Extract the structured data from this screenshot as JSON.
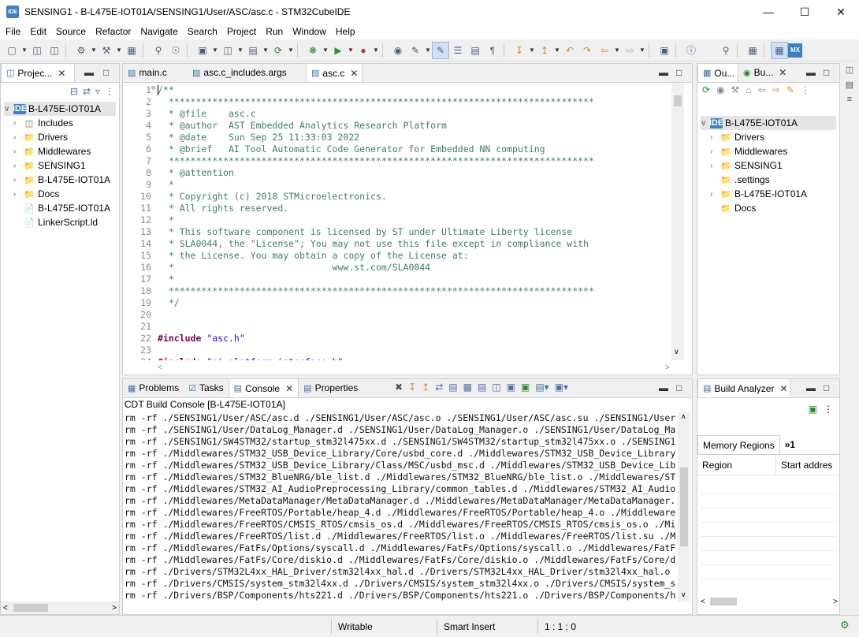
{
  "window": {
    "title": "SENSING1 - B-L475E-IOT01A/SENSING1/User/ASC/asc.c - STM32CubeIDE",
    "logo_text": "IDE"
  },
  "menu": [
    "File",
    "Edit",
    "Source",
    "Refactor",
    "Navigate",
    "Search",
    "Project",
    "Run",
    "Window",
    "Help"
  ],
  "project_explorer": {
    "tab_label": "Projec...",
    "root": "B-L475E-IOT01A",
    "items": [
      {
        "label": "Includes",
        "icon": "includes-icon"
      },
      {
        "label": "Drivers",
        "icon": "folder-icon"
      },
      {
        "label": "Middlewares",
        "icon": "folder-icon"
      },
      {
        "label": "SENSING1",
        "icon": "folder-icon"
      },
      {
        "label": "B-L475E-IOT01A",
        "icon": "folder-icon"
      },
      {
        "label": "Docs",
        "icon": "folder-icon"
      },
      {
        "label": "B-L475E-IOT01A",
        "icon": "file-icon"
      },
      {
        "label": "LinkerScript.ld",
        "icon": "file-icon"
      }
    ]
  },
  "editor": {
    "tabs": [
      "main.c",
      "asc.c_includes.args",
      "asc.c"
    ],
    "active_tab": "asc.c",
    "lines": [
      {
        "n": "1",
        "text": "/**",
        "cls": "cm",
        "fold": "⊖"
      },
      {
        "n": "2",
        "text": "  ******************************************************************************",
        "cls": "cm"
      },
      {
        "n": "3",
        "text": "  * @file    asc.c",
        "cls": "cm"
      },
      {
        "n": "4",
        "text": "  * @author  AST Embedded Analytics Research Platform",
        "cls": "cm"
      },
      {
        "n": "5",
        "text": "  * @date    Sun Sep 25 11:33:03 2022",
        "cls": "cm"
      },
      {
        "n": "6",
        "text": "  * @brief   AI Tool Automatic Code Generator for Embedded NN computing",
        "cls": "cm"
      },
      {
        "n": "7",
        "text": "  ******************************************************************************",
        "cls": "cm"
      },
      {
        "n": "8",
        "text": "  * @attention",
        "cls": "cm"
      },
      {
        "n": "9",
        "text": "  *",
        "cls": "cm"
      },
      {
        "n": "10",
        "text": "  * Copyright (c) 2018 STMicroelectronics.",
        "cls": "cm"
      },
      {
        "n": "11",
        "text": "  * All rights reserved.",
        "cls": "cm"
      },
      {
        "n": "12",
        "text": "  *",
        "cls": "cm"
      },
      {
        "n": "13",
        "text": "  * This software component is licensed by ST under Ultimate Liberty license",
        "cls": "cm"
      },
      {
        "n": "14",
        "text": "  * SLA0044, the \"License\"; You may not use this file except in compliance with",
        "cls": "cm"
      },
      {
        "n": "15",
        "text": "  * the License. You may obtain a copy of the License at:",
        "cls": "cm"
      },
      {
        "n": "16",
        "text": "  *                             www.st.com/SLA0044",
        "cls": "cm"
      },
      {
        "n": "17",
        "text": "  *",
        "cls": "cm"
      },
      {
        "n": "18",
        "text": "  ******************************************************************************",
        "cls": "cm"
      },
      {
        "n": "19",
        "text": "  */",
        "cls": "cm"
      },
      {
        "n": "20",
        "text": "",
        "cls": ""
      },
      {
        "n": "21",
        "text": "",
        "cls": ""
      },
      {
        "n": "22",
        "kw": "#include ",
        "str": "\"asc.h\""
      },
      {
        "n": "23",
        "text": "",
        "cls": ""
      },
      {
        "n": "24",
        "kw": "#include ",
        "str": "\"ai_platform_interface.h\""
      }
    ]
  },
  "outline": {
    "tabs": [
      "Ou...",
      "Bu..."
    ],
    "root": "B-L475E-IOT01A",
    "items": [
      "Drivers",
      "Middlewares",
      "SENSING1",
      ".settings",
      "B-L475E-IOT01A",
      "Docs"
    ]
  },
  "console_view": {
    "tabs": [
      "Problems",
      "Tasks",
      "Console",
      "Properties"
    ],
    "active_tab": "Console",
    "header": "CDT Build Console [B-L475E-IOT01A]",
    "lines": [
      "rm -rf ./SENSING1/User/ASC/asc.d ./SENSING1/User/ASC/asc.o ./SENSING1/User/ASC/asc.su ./SENSING1/User",
      "rm -rf ./SENSING1/User/DataLog_Manager.d ./SENSING1/User/DataLog_Manager.o ./SENSING1/User/DataLog_Ma",
      "rm -rf ./SENSING1/SW4STM32/startup_stm32l475xx.d ./SENSING1/SW4STM32/startup_stm32l475xx.o ./SENSING1",
      "rm -rf ./Middlewares/STM32_USB_Device_Library/Core/usbd_core.d ./Middlewares/STM32_USB_Device_Library",
      "rm -rf ./Middlewares/STM32_USB_Device_Library/Class/MSC/usbd_msc.d ./Middlewares/STM32_USB_Device_Lib",
      "rm -rf ./Middlewares/STM32_BlueNRG/ble_list.d ./Middlewares/STM32_BlueNRG/ble_list.o ./Middlewares/ST",
      "rm -rf ./Middlewares/STM32_AI_AudioPreprocessing_Library/common_tables.d ./Middlewares/STM32_AI_Audio",
      "rm -rf ./Middlewares/MetaDataManager/MetaDataManager.d ./Middlewares/MetaDataManager/MetaDataManager.",
      "rm -rf ./Middlewares/FreeRTOS/Portable/heap_4.d ./Middlewares/FreeRTOS/Portable/heap_4.o ./Middleware",
      "rm -rf ./Middlewares/FreeRTOS/CMSIS_RTOS/cmsis_os.d ./Middlewares/FreeRTOS/CMSIS_RTOS/cmsis_os.o ./Mi",
      "rm -rf ./Middlewares/FreeRTOS/list.d ./Middlewares/FreeRTOS/list.o ./Middlewares/FreeRTOS/list.su ./M",
      "rm -rf ./Middlewares/FatFs/Options/syscall.d ./Middlewares/FatFs/Options/syscall.o ./Middlewares/FatF",
      "rm -rf ./Middlewares/FatFs/Core/diskio.d ./Middlewares/FatFs/Core/diskio.o ./Middlewares/FatFs/Core/d",
      "rm -rf ./Drivers/STM32L4xx_HAL_Driver/stm32l4xx_hal.d ./Drivers/STM32L4xx_HAL_Driver/stm32l4xx_hal.o",
      "rm -rf ./Drivers/CMSIS/system_stm32l4xx.d ./Drivers/CMSIS/system_stm32l4xx.o ./Drivers/CMSIS/system_s",
      "rm -rf ./Drivers/BSP/Components/hts221.d ./Drivers/BSP/Components/hts221.o ./Drivers/BSP/Components/h"
    ]
  },
  "build_analyzer": {
    "tab_label": "Build Analyzer",
    "subtab": "Memory Regions",
    "more_tabs": "»1",
    "columns": [
      "Region",
      "Start addres"
    ]
  },
  "status": {
    "writable": "Writable",
    "insert_mode": "Smart Insert",
    "position": "1 : 1 : 0"
  }
}
